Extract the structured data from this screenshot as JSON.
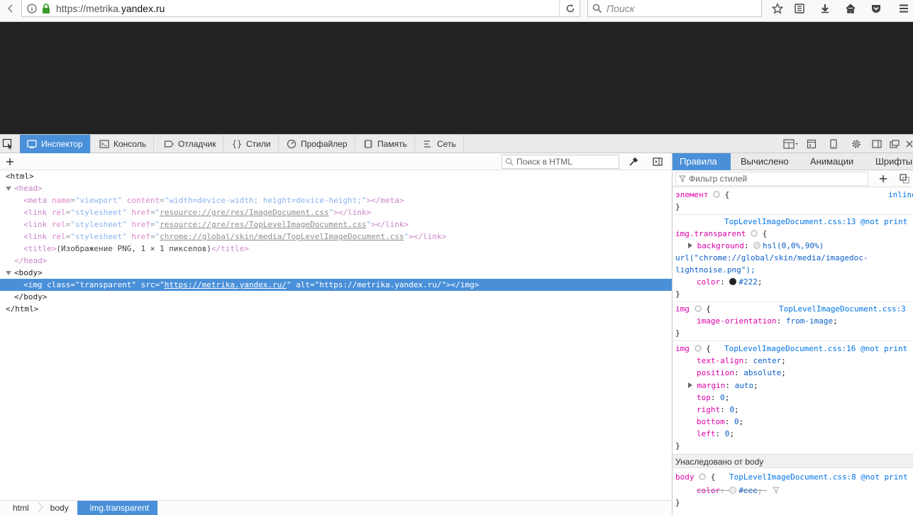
{
  "browser": {
    "url_prefix": "https://metrika.",
    "url_domain": "yandex.ru",
    "search_placeholder": "Поиск"
  },
  "devtools": {
    "tabs": [
      {
        "label": "Инспектор",
        "icon": "inspector-icon"
      },
      {
        "label": "Консоль",
        "icon": "console-icon"
      },
      {
        "label": "Отладчик",
        "icon": "debugger-icon"
      },
      {
        "label": "Стили",
        "icon": "styles-icon"
      },
      {
        "label": "Профайлер",
        "icon": "profiler-icon"
      },
      {
        "label": "Память",
        "icon": "memory-icon"
      },
      {
        "label": "Сеть",
        "icon": "network-icon"
      }
    ],
    "active_tab": "Инспектор",
    "html_search_placeholder": "Поиск в HTML",
    "markup": {
      "html_open": "<html>",
      "head_open": "<head>",
      "meta_name": "viewport",
      "meta_content": "width=device-width; height=device-height;",
      "link1": "resource://gre/res/ImageDocument.css",
      "link2": "resource://gre/res/TopLevelImageDocument.css",
      "link3": "chrome://global/skin/media/TopLevelImageDocument.css",
      "title_text": "(Изображение PNG, 1 × 1 пикселов)",
      "img_class": "transparent",
      "img_src": "https://metrika.yandex.ru/",
      "img_alt": "https://metrika.yandex.ru/"
    },
    "breadcrumbs": [
      "html",
      "body",
      "img.transparent"
    ]
  },
  "sidebar": {
    "tabs": [
      "Правила",
      "Вычислено",
      "Анимации",
      "Шрифты"
    ],
    "active_tab": "Правила",
    "filter_placeholder": "Фильтр стилей",
    "rules": {
      "element_label": "элемент",
      "element_source": "inline",
      "rule1_source": "TopLevelImageDocument.css:13 @not print",
      "rule1_selector": "img.transparent",
      "rule1_bg_prop": "background",
      "rule1_bg_val": "hsl(0,0%,90%)",
      "rule1_bg_url": "url(\"chrome://global/skin/media/imagedoc-",
      "rule1_bg_url2": "lightnoise.png\");",
      "rule1_color_prop": "color",
      "rule1_color_val": "#222",
      "rule2_selector": "img",
      "rule2_source": "TopLevelImageDocument.css:3",
      "rule2_prop": "image-orientation",
      "rule2_val": "from-image",
      "rule3_selector": "img",
      "rule3_source": "TopLevelImageDocument.css:16 @not print",
      "rule3_props": [
        {
          "name": "text-align",
          "value": "center"
        },
        {
          "name": "position",
          "value": "absolute"
        },
        {
          "name": "margin",
          "value": "auto"
        },
        {
          "name": "top",
          "value": "0"
        },
        {
          "name": "right",
          "value": "0"
        },
        {
          "name": "bottom",
          "value": "0"
        },
        {
          "name": "left",
          "value": "0"
        }
      ],
      "inherited_label": "Унаследовано от body",
      "rule4_selector": "body",
      "rule4_source": "TopLevelImageDocument.css:8 @not print",
      "rule4_prop": "color",
      "rule4_val": "#eee"
    }
  },
  "colors": {
    "accent": "#4a90d9",
    "page_bg": "#222222"
  }
}
